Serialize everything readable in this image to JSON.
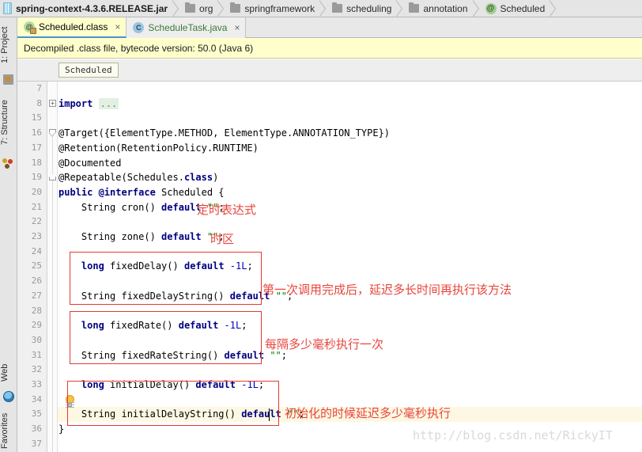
{
  "breadcrumb": {
    "items": [
      {
        "label": "spring-context-4.3.6.RELEASE.jar",
        "icon": "jar-icon"
      },
      {
        "label": "org",
        "icon": "folder-icon"
      },
      {
        "label": "springframework",
        "icon": "folder-icon"
      },
      {
        "label": "scheduling",
        "icon": "folder-icon"
      },
      {
        "label": "annotation",
        "icon": "folder-icon"
      },
      {
        "label": "Scheduled",
        "icon": "annotation-icon",
        "glyph": "@"
      }
    ]
  },
  "tabs": [
    {
      "label": "Scheduled.class",
      "close": "×",
      "icon": "class-annotation-icon",
      "glyph": "@",
      "active": true
    },
    {
      "label": "ScheduleTask.java",
      "close": "×",
      "icon": "java-class-icon",
      "glyph": "C",
      "active": false
    }
  ],
  "notification": {
    "text": "Decompiled .class file, bytecode version: 50.0 (Java 6)"
  },
  "editor_breadcrumb": {
    "chip": "Scheduled"
  },
  "tool_strip": {
    "left_tabs": [
      {
        "label": "1: Project",
        "icon": "module-icon"
      },
      {
        "label": "7: Structure",
        "icon": "structure-icon"
      },
      {
        "label": "Web",
        "icon": "web-icon"
      },
      {
        "label": "Favorites",
        "icon": "favorites-icon"
      }
    ]
  },
  "code": {
    "line_numbers": [
      "7",
      "8",
      "15",
      "16",
      "17",
      "18",
      "19",
      "20",
      "21",
      "22",
      "23",
      "24",
      "25",
      "26",
      "27",
      "28",
      "29",
      "30",
      "31",
      "32",
      "33",
      "34",
      "35",
      "36",
      "37"
    ],
    "highlighted_line": "35",
    "lines": [
      {
        "n": "7",
        "text": ""
      },
      {
        "n": "8",
        "text": "import ...",
        "fold": "plus"
      },
      {
        "n": "15",
        "text": ""
      },
      {
        "n": "16",
        "text": "@Target({ElementType.METHOD, ElementType.ANNOTATION_TYPE})",
        "fold": "open"
      },
      {
        "n": "17",
        "text": "@Retention(RetentionPolicy.RUNTIME)"
      },
      {
        "n": "18",
        "text": "@Documented"
      },
      {
        "n": "19",
        "text": "@Repeatable(Schedules.class)",
        "fold": "end"
      },
      {
        "n": "20",
        "text": "public @interface Scheduled {"
      },
      {
        "n": "21",
        "text": "    String cron() default \"\";"
      },
      {
        "n": "22",
        "text": ""
      },
      {
        "n": "23",
        "text": "    String zone() default \"\";"
      },
      {
        "n": "24",
        "text": ""
      },
      {
        "n": "25",
        "text": "    long fixedDelay() default -1L;"
      },
      {
        "n": "26",
        "text": ""
      },
      {
        "n": "27",
        "text": "    String fixedDelayString() default \"\";"
      },
      {
        "n": "28",
        "text": ""
      },
      {
        "n": "29",
        "text": "    long fixedRate() default -1L;"
      },
      {
        "n": "30",
        "text": ""
      },
      {
        "n": "31",
        "text": "    String fixedRateString() default \"\";"
      },
      {
        "n": "32",
        "text": ""
      },
      {
        "n": "33",
        "text": "    long initialDelay() default -1L;"
      },
      {
        "n": "34",
        "text": ""
      },
      {
        "n": "35",
        "text": "    String initialDelayString() default \"\";"
      },
      {
        "n": "36",
        "text": "}"
      },
      {
        "n": "37",
        "text": ""
      }
    ]
  },
  "annotations": {
    "color": "#e8453c",
    "notes": [
      {
        "id": "cron-note",
        "text": "定时表达式"
      },
      {
        "id": "zone-note",
        "text": "时区"
      },
      {
        "id": "fixed-delay-note",
        "text": "第一次调用完成后，延迟多长时间再执行该方法"
      },
      {
        "id": "fixed-rate-note",
        "text": "每隔多少毫秒执行一次"
      },
      {
        "id": "initial-delay-note",
        "text": "初始化的时候延迟多少毫秒执行"
      }
    ],
    "boxes": [
      "fixed-delay-box",
      "fixed-rate-box",
      "initial-delay-box"
    ]
  },
  "watermark": {
    "text": "http://blog.csdn.net/RickyIT"
  },
  "colors": {
    "accent": "#4a90d9",
    "annotation_red": "#e8453c",
    "notification_bg": "#ffffcc",
    "keyword": "#000080",
    "string": "#008000",
    "highlight_line": "#fdf8e3"
  }
}
